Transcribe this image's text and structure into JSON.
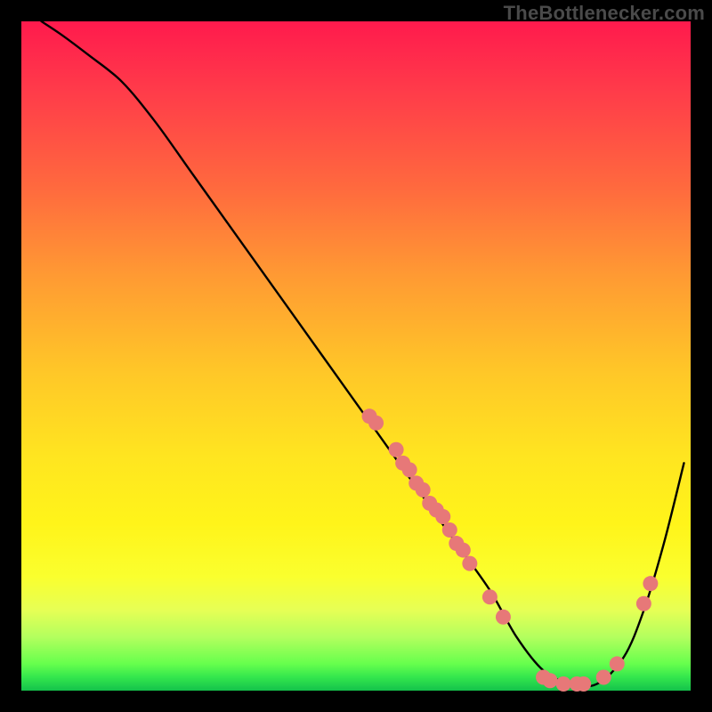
{
  "watermark": "TheBottlenecker.com",
  "colors": {
    "curve_stroke": "#000000",
    "dot_fill": "#e77878",
    "background_top": "#ff1a4d",
    "background_bottom": "#14c24b"
  },
  "chart_data": {
    "type": "line",
    "title": "",
    "xlabel": "",
    "ylabel": "",
    "xlim": [
      0,
      100
    ],
    "ylim": [
      0,
      100
    ],
    "x": [
      3,
      6,
      10,
      15,
      20,
      25,
      30,
      35,
      40,
      45,
      50,
      55,
      60,
      65,
      70,
      74,
      78,
      82,
      86,
      90,
      93,
      96,
      99
    ],
    "values": [
      100,
      98,
      95,
      91,
      85,
      78,
      71,
      64,
      57,
      50,
      43,
      36,
      29,
      22,
      15,
      8,
      3,
      1,
      1,
      5,
      12,
      22,
      34
    ],
    "minimum_region_x": [
      78,
      88
    ],
    "scatter_points": [
      {
        "x": 52,
        "y": 41
      },
      {
        "x": 53,
        "y": 40
      },
      {
        "x": 56,
        "y": 36
      },
      {
        "x": 57,
        "y": 34
      },
      {
        "x": 58,
        "y": 33
      },
      {
        "x": 59,
        "y": 31
      },
      {
        "x": 60,
        "y": 30
      },
      {
        "x": 61,
        "y": 28
      },
      {
        "x": 62,
        "y": 27
      },
      {
        "x": 63,
        "y": 26
      },
      {
        "x": 64,
        "y": 24
      },
      {
        "x": 65,
        "y": 22
      },
      {
        "x": 66,
        "y": 21
      },
      {
        "x": 67,
        "y": 19
      },
      {
        "x": 70,
        "y": 14
      },
      {
        "x": 72,
        "y": 11
      },
      {
        "x": 78,
        "y": 2
      },
      {
        "x": 79,
        "y": 1.5
      },
      {
        "x": 81,
        "y": 1
      },
      {
        "x": 83,
        "y": 1
      },
      {
        "x": 84,
        "y": 1
      },
      {
        "x": 87,
        "y": 2
      },
      {
        "x": 89,
        "y": 4
      },
      {
        "x": 93,
        "y": 13
      },
      {
        "x": 94,
        "y": 16
      }
    ]
  }
}
